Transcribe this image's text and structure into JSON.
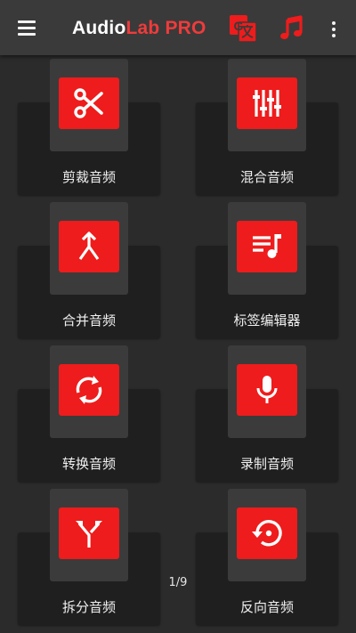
{
  "app": {
    "title_part1": "Audio",
    "title_part2": "Lab",
    "title_part3": "PRO",
    "accent_color": "#ee1c1c"
  },
  "toolbar": {
    "menu_icon": "hamburger-menu-icon",
    "translate_icon": "translate-icon",
    "music_icon": "music-note-icon",
    "more_icon": "more-vert-icon"
  },
  "tools": [
    {
      "label": "剪裁音频",
      "icon": "scissors-icon"
    },
    {
      "label": "混合音频",
      "icon": "mixer-sliders-icon"
    },
    {
      "label": "合并音频",
      "icon": "merge-arrow-icon"
    },
    {
      "label": "标签编辑器",
      "icon": "playlist-music-icon"
    },
    {
      "label": "转换音频",
      "icon": "convert-sync-icon"
    },
    {
      "label": "录制音频",
      "icon": "microphone-icon"
    },
    {
      "label": "拆分音频",
      "icon": "split-arrow-icon"
    },
    {
      "label": "反向音频",
      "icon": "reverse-restore-icon"
    }
  ],
  "pager": {
    "text": "1/9"
  }
}
